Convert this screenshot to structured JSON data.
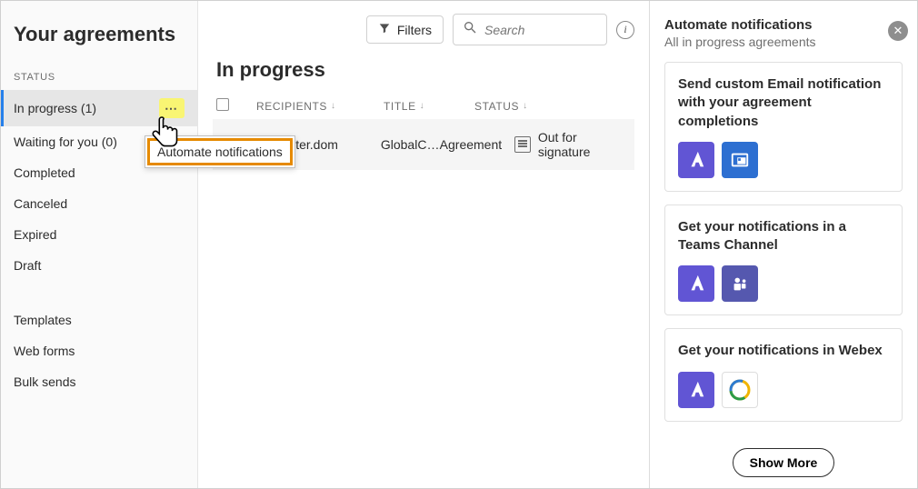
{
  "pageTitle": "Your agreements",
  "toolbar": {
    "filters": "Filters",
    "searchPlaceholder": "Search"
  },
  "sidebar": {
    "statusHeading": "STATUS",
    "items": [
      {
        "label": "In progress (1)",
        "selected": true,
        "hasMore": true
      },
      {
        "label": "Waiting for you (0)"
      },
      {
        "label": "Completed"
      },
      {
        "label": "Canceled"
      },
      {
        "label": "Expired"
      },
      {
        "label": "Draft"
      }
    ],
    "secondary": [
      {
        "label": "Templates"
      },
      {
        "label": "Web forms"
      },
      {
        "label": "Bulk sends"
      }
    ]
  },
  "popup": {
    "menuItem": "Automate notifications"
  },
  "section": {
    "title": "In progress",
    "columns": {
      "recipients": "RECIPIENTS",
      "title": "TITLE",
      "status": "STATUS"
    },
    "row": {
      "recipient": "e@jupiter.dom",
      "title": "GlobalC…",
      "type": "Agreement",
      "status": "Out for signature"
    }
  },
  "panel": {
    "title": "Automate notifications",
    "subtitle": "All in progress agreements",
    "cards": [
      {
        "title": "Send custom Email notification with your agreement completions",
        "icons": [
          "adobe",
          "outlook"
        ]
      },
      {
        "title": "Get your notifications in a Teams Channel",
        "icons": [
          "adobe",
          "teams"
        ]
      },
      {
        "title": "Get your notifications in Webex",
        "icons": [
          "adobe",
          "webex"
        ]
      }
    ],
    "showMore": "Show More"
  }
}
